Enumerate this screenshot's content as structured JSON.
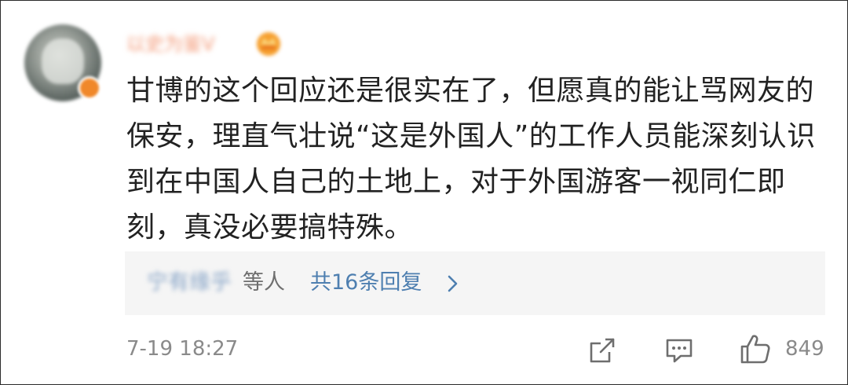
{
  "comment": {
    "username": "以史为鉴V",
    "text": "甘博的这个回应还是很实在了，但愿真的能让骂网友的保安，理直气壮说“这是外国人”的工作人员能深刻认识到在中国人自己的土地上，对于外国游客一视同仁即刻，真没必要搞特殊。",
    "replies": {
      "names": "宁有缘乎",
      "etc": "等人",
      "count_label": "共16条回复"
    },
    "timestamp": "7-19 18:27",
    "like_count": "849"
  },
  "icons": {
    "share": "share-icon",
    "comment": "comment-icon",
    "like": "like-icon",
    "chevron": "chevron-right-icon",
    "verify": "verified-badge-icon",
    "crown": "crown-icon"
  },
  "colors": {
    "reply_link": "#4e7fb0",
    "meta_text": "#8a8a8a",
    "body_text": "#222222",
    "reply_bg": "#f5f5f5",
    "username": "#f39a78"
  }
}
